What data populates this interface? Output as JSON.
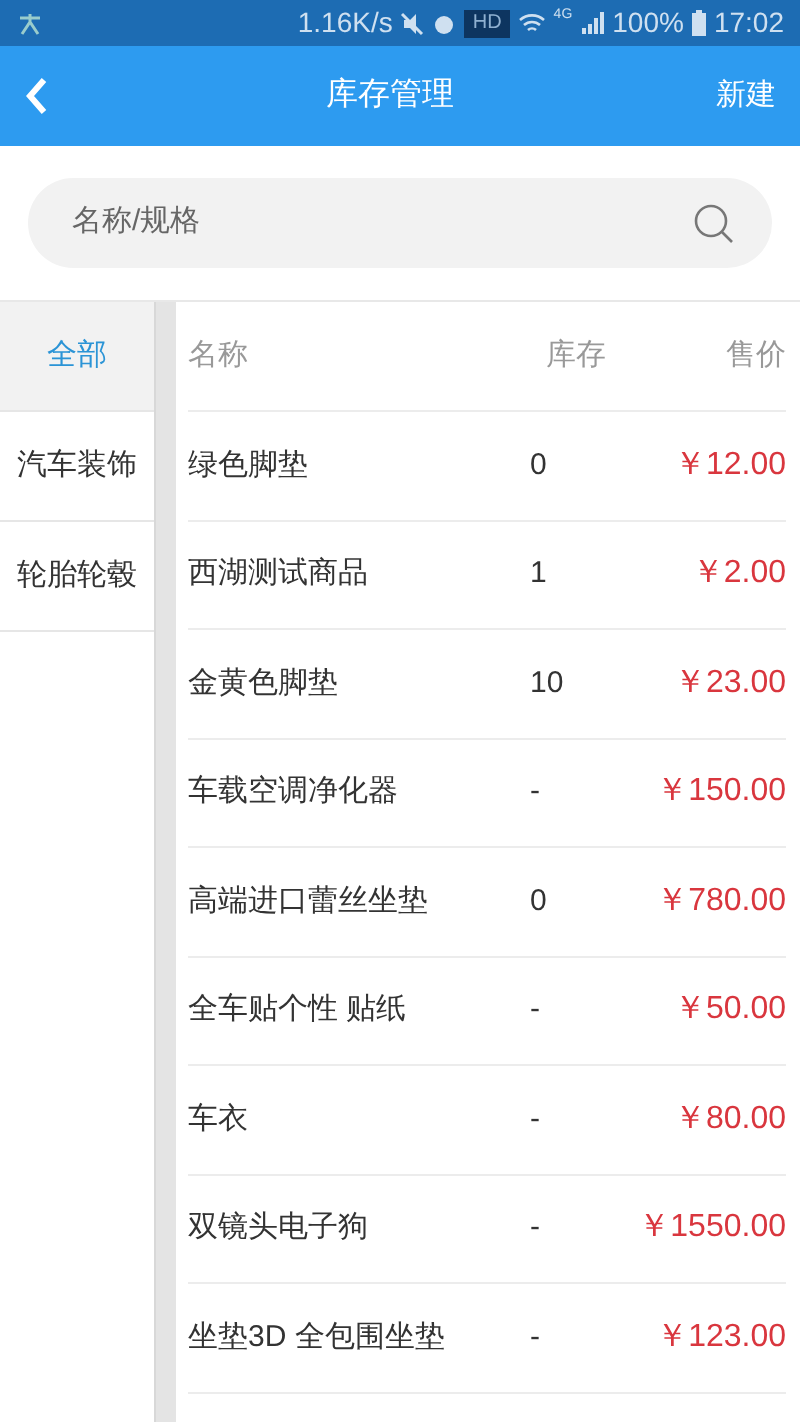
{
  "status_bar": {
    "speed": "1.16K/s",
    "hd": "HD",
    "network": "4G",
    "battery": "100%",
    "time": "17:02"
  },
  "header": {
    "title": "库存管理",
    "action": "新建"
  },
  "search": {
    "placeholder": "名称/规格"
  },
  "categories": [
    {
      "label": "全部",
      "selected": true
    },
    {
      "label": "汽车装饰",
      "selected": false
    },
    {
      "label": "轮胎轮毂",
      "selected": false
    }
  ],
  "table": {
    "columns": [
      "名称",
      "库存",
      "售价"
    ],
    "rows": [
      {
        "name": "绿色脚垫",
        "stock": "0",
        "price": "￥12.00"
      },
      {
        "name": "西湖测试商品",
        "stock": "1",
        "price": "￥2.00"
      },
      {
        "name": "金黄色脚垫",
        "stock": "10",
        "price": "￥23.00"
      },
      {
        "name": "车载空调净化器",
        "stock": "-",
        "price": "￥150.00"
      },
      {
        "name": "高端进口蕾丝坐垫",
        "stock": "0",
        "price": "￥780.00"
      },
      {
        "name": "全车贴个性 贴纸",
        "stock": "-",
        "price": "￥50.00"
      },
      {
        "name": "车衣",
        "stock": "-",
        "price": "￥80.00"
      },
      {
        "name": "双镜头电子狗",
        "stock": "-",
        "price": "￥1550.00"
      },
      {
        "name": "坐垫3D 全包围坐垫",
        "stock": "-",
        "price": "￥123.00"
      }
    ]
  }
}
